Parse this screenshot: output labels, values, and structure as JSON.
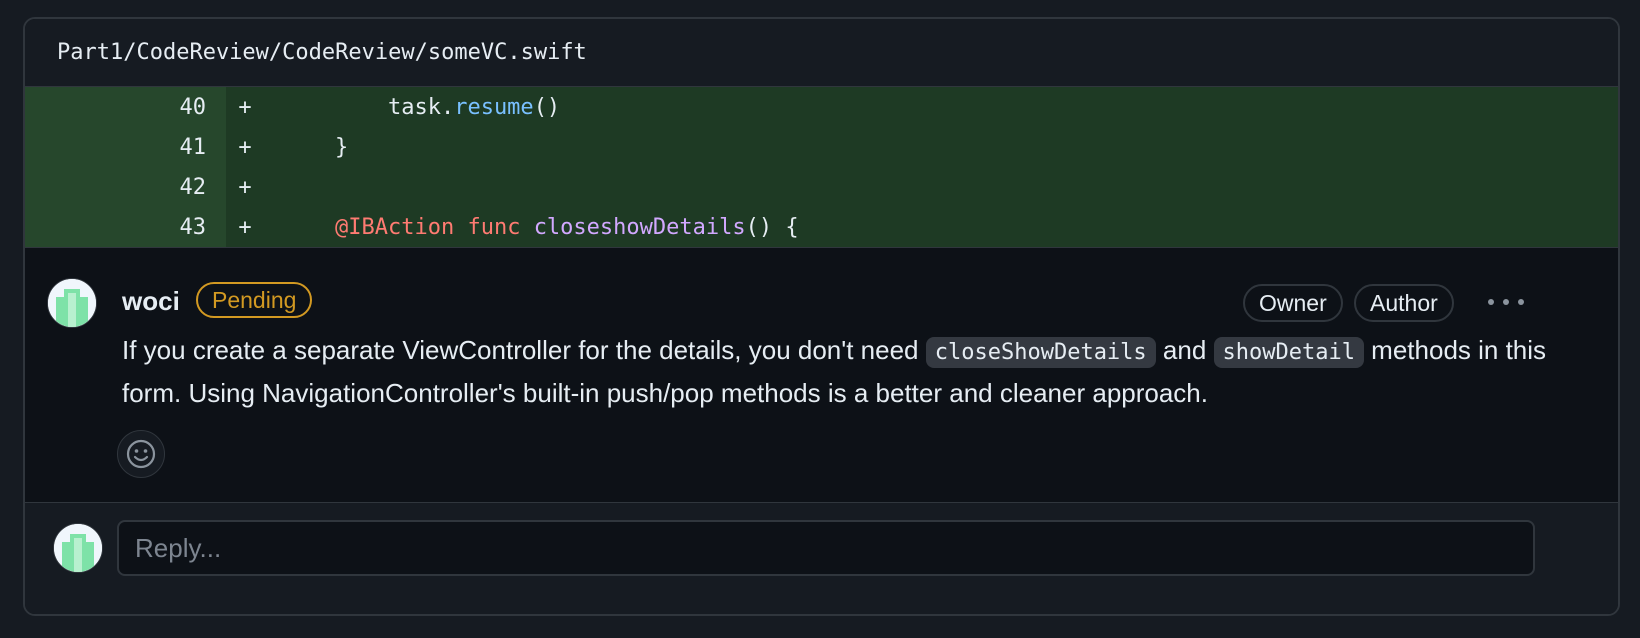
{
  "file": {
    "path": "Part1/CodeReview/CodeReview/someVC.swift"
  },
  "diff": {
    "lines": [
      {
        "number": "40",
        "sign": "+",
        "indent": "        ",
        "parts": [
          {
            "text": "task.",
            "cls": ""
          },
          {
            "text": "resume",
            "cls": "tok-method"
          },
          {
            "text": "()",
            "cls": ""
          }
        ]
      },
      {
        "number": "41",
        "sign": "+",
        "indent": "    ",
        "parts": [
          {
            "text": "}",
            "cls": ""
          }
        ]
      },
      {
        "number": "42",
        "sign": "+",
        "indent": "",
        "parts": []
      },
      {
        "number": "43",
        "sign": "+",
        "indent": "    ",
        "parts": [
          {
            "text": "@IBAction",
            "cls": "tok-attr"
          },
          {
            "text": " ",
            "cls": ""
          },
          {
            "text": "func",
            "cls": "tok-kw"
          },
          {
            "text": " ",
            "cls": ""
          },
          {
            "text": "closeshowDetails",
            "cls": "tok-fn"
          },
          {
            "text": "() {",
            "cls": ""
          }
        ]
      }
    ]
  },
  "comment": {
    "author": "woci",
    "status": "Pending",
    "roles": [
      "Owner",
      "Author"
    ],
    "more_icon": "kebab-horizontal-icon",
    "text_part1": "If you create a separate ViewController for the details, you don't need ",
    "code1": "closeShowDetails",
    "text_part2": " and ",
    "code2": "showDetail",
    "text_part3": " methods in this form. Using NavigationController's built-in push/pop methods is a better and cleaner approach.",
    "reaction_icon": "smiley-icon"
  },
  "reply": {
    "placeholder": "Reply..."
  },
  "colors": {
    "addition_bg": "#1e3a24",
    "addition_gutter": "#26472c",
    "pending": "#d29922",
    "avatar_green": "#3fb950"
  }
}
